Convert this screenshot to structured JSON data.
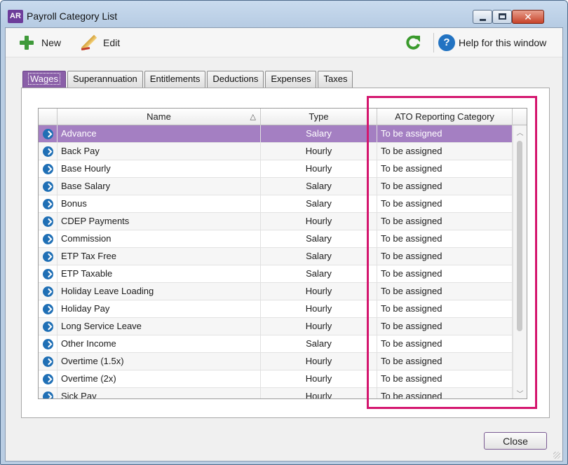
{
  "window": {
    "app_badge": "AR",
    "title": "Payroll Category List"
  },
  "toolbar": {
    "new_label": "New",
    "edit_label": "Edit",
    "help_label": "Help for this window"
  },
  "tabs": [
    {
      "label": "Wages",
      "active": true
    },
    {
      "label": "Superannuation"
    },
    {
      "label": "Entitlements"
    },
    {
      "label": "Deductions"
    },
    {
      "label": "Expenses"
    },
    {
      "label": "Taxes"
    }
  ],
  "grid": {
    "columns": {
      "name": "Name",
      "type": "Type",
      "ato": "ATO Reporting Category"
    },
    "sort_indicator": "△",
    "rows": [
      {
        "name": "Advance",
        "type": "Salary",
        "ato": "To be assigned",
        "selected": true
      },
      {
        "name": "Back Pay",
        "type": "Hourly",
        "ato": "To be assigned"
      },
      {
        "name": "Base Hourly",
        "type": "Hourly",
        "ato": "To be assigned"
      },
      {
        "name": "Base Salary",
        "type": "Salary",
        "ato": "To be assigned"
      },
      {
        "name": "Bonus",
        "type": "Salary",
        "ato": "To be assigned"
      },
      {
        "name": "CDEP Payments",
        "type": "Hourly",
        "ato": "To be assigned"
      },
      {
        "name": "Commission",
        "type": "Salary",
        "ato": "To be assigned"
      },
      {
        "name": "ETP Tax Free",
        "type": "Salary",
        "ato": "To be assigned"
      },
      {
        "name": "ETP Taxable",
        "type": "Salary",
        "ato": "To be assigned"
      },
      {
        "name": "Holiday Leave Loading",
        "type": "Hourly",
        "ato": "To be assigned"
      },
      {
        "name": "Holiday Pay",
        "type": "Hourly",
        "ato": "To be assigned"
      },
      {
        "name": "Long Service Leave",
        "type": "Hourly",
        "ato": "To be assigned"
      },
      {
        "name": "Other Income",
        "type": "Salary",
        "ato": "To be assigned"
      },
      {
        "name": "Overtime (1.5x)",
        "type": "Hourly",
        "ato": "To be assigned"
      },
      {
        "name": "Overtime (2x)",
        "type": "Hourly",
        "ato": "To be assigned"
      },
      {
        "name": "Sick Pay",
        "type": "Hourly",
        "ato": "To be assigned"
      }
    ]
  },
  "footer": {
    "close_label": "Close"
  },
  "colors": {
    "accent_purple": "#8a5fa8",
    "selected_row": "#a47fc2",
    "highlight_box": "#d4166e",
    "row_arrow": "#1f6fb5"
  }
}
